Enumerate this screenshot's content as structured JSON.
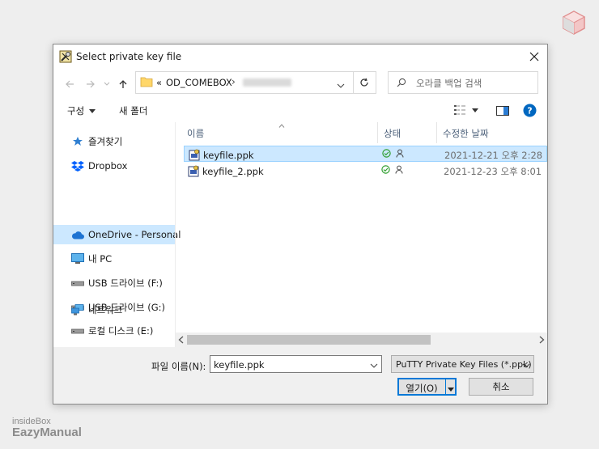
{
  "dialog": {
    "title": "Select private key file",
    "nav": {
      "breadcrumb_overflow": "«",
      "breadcrumb_folder": "OD_COMEBOX",
      "breadcrumb_separator": "›",
      "search_placeholder": "오라클 백업 검색"
    },
    "commands": {
      "organize": "구성",
      "new_folder": "새 폴더"
    },
    "sidebar": {
      "items": [
        {
          "label": "즐겨찾기",
          "icon": "star-icon"
        },
        {
          "label": "Dropbox",
          "icon": "dropbox-icon"
        },
        {
          "label": "OneDrive - Personal",
          "icon": "cloud-icon",
          "selected": true
        },
        {
          "label": "내 PC",
          "icon": "monitor-icon"
        },
        {
          "label": "USB 드라이브 (F:)",
          "icon": "drive-icon"
        },
        {
          "label": "USB 드라이브 (G:)",
          "icon": "drive-icon"
        },
        {
          "label": "로컬 디스크 (E:)",
          "icon": "drive-icon"
        },
        {
          "label": "네트워크",
          "icon": "network-icon"
        }
      ]
    },
    "file_list": {
      "columns": {
        "name": "이름",
        "status": "상태",
        "modified": "수정한 날짜"
      },
      "files": [
        {
          "name": "keyfile.ppk",
          "modified": "2021-12-21 오후 2:28",
          "selected": true
        },
        {
          "name": "keyfile_2.ppk",
          "modified": "2021-12-23 오후 8:01",
          "selected": false
        }
      ]
    },
    "bottom": {
      "filename_label": "파일 이름(N):",
      "filename_value": "keyfile.ppk",
      "filetype_value": "PuTTY Private Key Files (*.ppk)",
      "open_label": "열기(O)",
      "cancel_label": "취소"
    }
  },
  "watermark": {
    "line1": "insideBox",
    "line2": "EazyManual"
  },
  "colors": {
    "selection_bg": "#cce8ff",
    "selection_border": "#99d1ff",
    "accent": "#0078d7",
    "status_ok": "#2f9e2f",
    "help": "#0067c0"
  }
}
